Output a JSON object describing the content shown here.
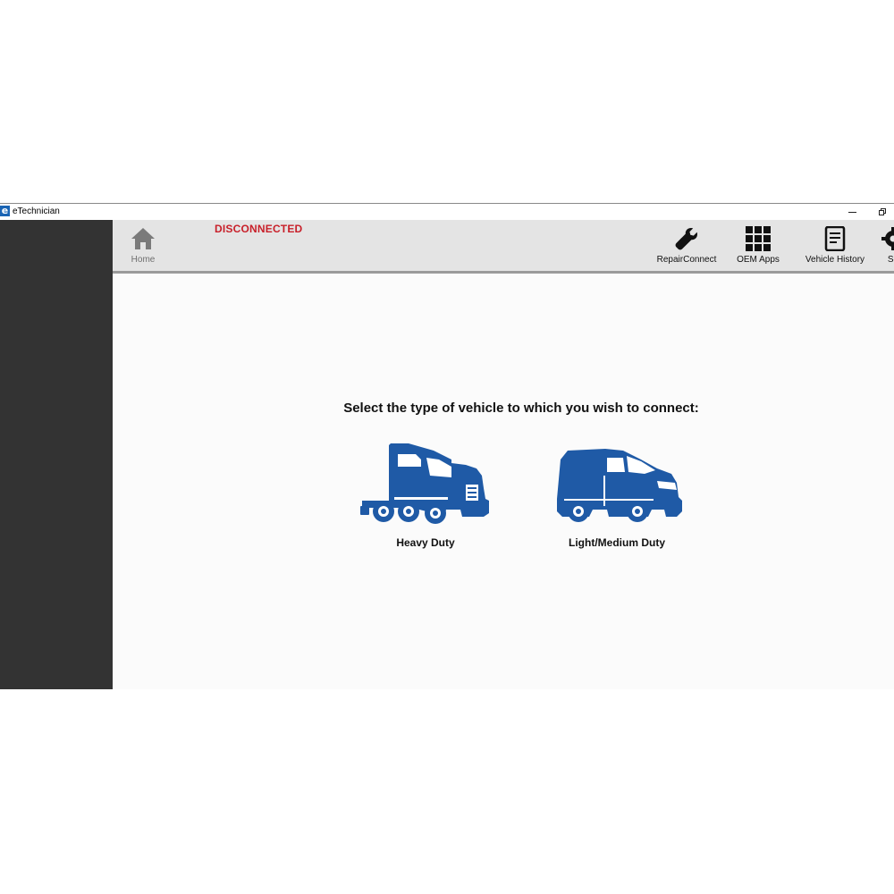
{
  "window": {
    "app_icon_letter": "e",
    "title": "eTechnician"
  },
  "toolbar": {
    "home_label": "Home",
    "status": "DISCONNECTED",
    "repair_label": "RepairConnect",
    "oem_label": "OEM Apps",
    "history_label": "Vehicle History",
    "settings_label": "Se"
  },
  "main": {
    "prompt": "Select the type of vehicle to which you wish to connect:",
    "options": [
      {
        "label": "Heavy Duty",
        "icon": "semi-truck-icon"
      },
      {
        "label": "Light/Medium Duty",
        "icon": "van-icon"
      }
    ]
  },
  "colors": {
    "accent_blue": "#1f5aa6",
    "status_red": "#c8202a",
    "sidebar": "#333333",
    "toolbar": "#e4e4e4"
  }
}
